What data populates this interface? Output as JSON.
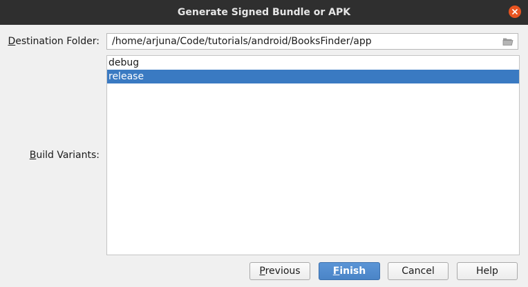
{
  "window": {
    "title": "Generate Signed Bundle or APK"
  },
  "destination": {
    "label_mnemonic": "D",
    "label_rest": "estination Folder:",
    "value": "/home/arjuna/Code/tutorials/android/BooksFinder/app"
  },
  "build_variants": {
    "label_mnemonic": "B",
    "label_rest": "uild Variants:",
    "items": [
      {
        "label": "debug",
        "selected": false
      },
      {
        "label": "release",
        "selected": true
      }
    ]
  },
  "buttons": {
    "previous": {
      "mnemonic": "P",
      "rest": "revious"
    },
    "finish": {
      "mnemonic": "F",
      "rest": "inish"
    },
    "cancel": {
      "label": "Cancel"
    },
    "help": {
      "label": "Help"
    }
  },
  "colors": {
    "titlebar": "#2f2f2f",
    "close": "#e95420",
    "selection": "#3a7ac2",
    "primary_button": "#4a84c7"
  },
  "icons": {
    "close": "close-icon",
    "folder": "folder-open-icon"
  }
}
